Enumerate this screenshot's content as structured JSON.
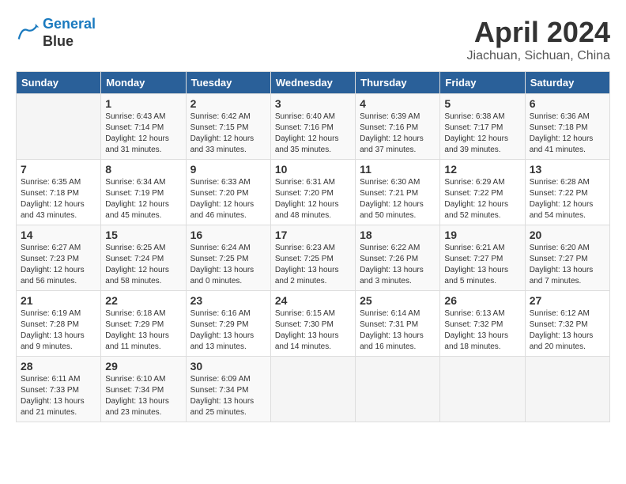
{
  "header": {
    "logo_line1": "General",
    "logo_line2": "Blue",
    "month": "April 2024",
    "location": "Jiachuan, Sichuan, China"
  },
  "weekdays": [
    "Sunday",
    "Monday",
    "Tuesday",
    "Wednesday",
    "Thursday",
    "Friday",
    "Saturday"
  ],
  "weeks": [
    [
      {
        "day": "",
        "info": ""
      },
      {
        "day": "1",
        "info": "Sunrise: 6:43 AM\nSunset: 7:14 PM\nDaylight: 12 hours\nand 31 minutes."
      },
      {
        "day": "2",
        "info": "Sunrise: 6:42 AM\nSunset: 7:15 PM\nDaylight: 12 hours\nand 33 minutes."
      },
      {
        "day": "3",
        "info": "Sunrise: 6:40 AM\nSunset: 7:16 PM\nDaylight: 12 hours\nand 35 minutes."
      },
      {
        "day": "4",
        "info": "Sunrise: 6:39 AM\nSunset: 7:16 PM\nDaylight: 12 hours\nand 37 minutes."
      },
      {
        "day": "5",
        "info": "Sunrise: 6:38 AM\nSunset: 7:17 PM\nDaylight: 12 hours\nand 39 minutes."
      },
      {
        "day": "6",
        "info": "Sunrise: 6:36 AM\nSunset: 7:18 PM\nDaylight: 12 hours\nand 41 minutes."
      }
    ],
    [
      {
        "day": "7",
        "info": "Sunrise: 6:35 AM\nSunset: 7:18 PM\nDaylight: 12 hours\nand 43 minutes."
      },
      {
        "day": "8",
        "info": "Sunrise: 6:34 AM\nSunset: 7:19 PM\nDaylight: 12 hours\nand 45 minutes."
      },
      {
        "day": "9",
        "info": "Sunrise: 6:33 AM\nSunset: 7:20 PM\nDaylight: 12 hours\nand 46 minutes."
      },
      {
        "day": "10",
        "info": "Sunrise: 6:31 AM\nSunset: 7:20 PM\nDaylight: 12 hours\nand 48 minutes."
      },
      {
        "day": "11",
        "info": "Sunrise: 6:30 AM\nSunset: 7:21 PM\nDaylight: 12 hours\nand 50 minutes."
      },
      {
        "day": "12",
        "info": "Sunrise: 6:29 AM\nSunset: 7:22 PM\nDaylight: 12 hours\nand 52 minutes."
      },
      {
        "day": "13",
        "info": "Sunrise: 6:28 AM\nSunset: 7:22 PM\nDaylight: 12 hours\nand 54 minutes."
      }
    ],
    [
      {
        "day": "14",
        "info": "Sunrise: 6:27 AM\nSunset: 7:23 PM\nDaylight: 12 hours\nand 56 minutes."
      },
      {
        "day": "15",
        "info": "Sunrise: 6:25 AM\nSunset: 7:24 PM\nDaylight: 12 hours\nand 58 minutes."
      },
      {
        "day": "16",
        "info": "Sunrise: 6:24 AM\nSunset: 7:25 PM\nDaylight: 13 hours\nand 0 minutes."
      },
      {
        "day": "17",
        "info": "Sunrise: 6:23 AM\nSunset: 7:25 PM\nDaylight: 13 hours\nand 2 minutes."
      },
      {
        "day": "18",
        "info": "Sunrise: 6:22 AM\nSunset: 7:26 PM\nDaylight: 13 hours\nand 3 minutes."
      },
      {
        "day": "19",
        "info": "Sunrise: 6:21 AM\nSunset: 7:27 PM\nDaylight: 13 hours\nand 5 minutes."
      },
      {
        "day": "20",
        "info": "Sunrise: 6:20 AM\nSunset: 7:27 PM\nDaylight: 13 hours\nand 7 minutes."
      }
    ],
    [
      {
        "day": "21",
        "info": "Sunrise: 6:19 AM\nSunset: 7:28 PM\nDaylight: 13 hours\nand 9 minutes."
      },
      {
        "day": "22",
        "info": "Sunrise: 6:18 AM\nSunset: 7:29 PM\nDaylight: 13 hours\nand 11 minutes."
      },
      {
        "day": "23",
        "info": "Sunrise: 6:16 AM\nSunset: 7:29 PM\nDaylight: 13 hours\nand 13 minutes."
      },
      {
        "day": "24",
        "info": "Sunrise: 6:15 AM\nSunset: 7:30 PM\nDaylight: 13 hours\nand 14 minutes."
      },
      {
        "day": "25",
        "info": "Sunrise: 6:14 AM\nSunset: 7:31 PM\nDaylight: 13 hours\nand 16 minutes."
      },
      {
        "day": "26",
        "info": "Sunrise: 6:13 AM\nSunset: 7:32 PM\nDaylight: 13 hours\nand 18 minutes."
      },
      {
        "day": "27",
        "info": "Sunrise: 6:12 AM\nSunset: 7:32 PM\nDaylight: 13 hours\nand 20 minutes."
      }
    ],
    [
      {
        "day": "28",
        "info": "Sunrise: 6:11 AM\nSunset: 7:33 PM\nDaylight: 13 hours\nand 21 minutes."
      },
      {
        "day": "29",
        "info": "Sunrise: 6:10 AM\nSunset: 7:34 PM\nDaylight: 13 hours\nand 23 minutes."
      },
      {
        "day": "30",
        "info": "Sunrise: 6:09 AM\nSunset: 7:34 PM\nDaylight: 13 hours\nand 25 minutes."
      },
      {
        "day": "",
        "info": ""
      },
      {
        "day": "",
        "info": ""
      },
      {
        "day": "",
        "info": ""
      },
      {
        "day": "",
        "info": ""
      }
    ]
  ]
}
